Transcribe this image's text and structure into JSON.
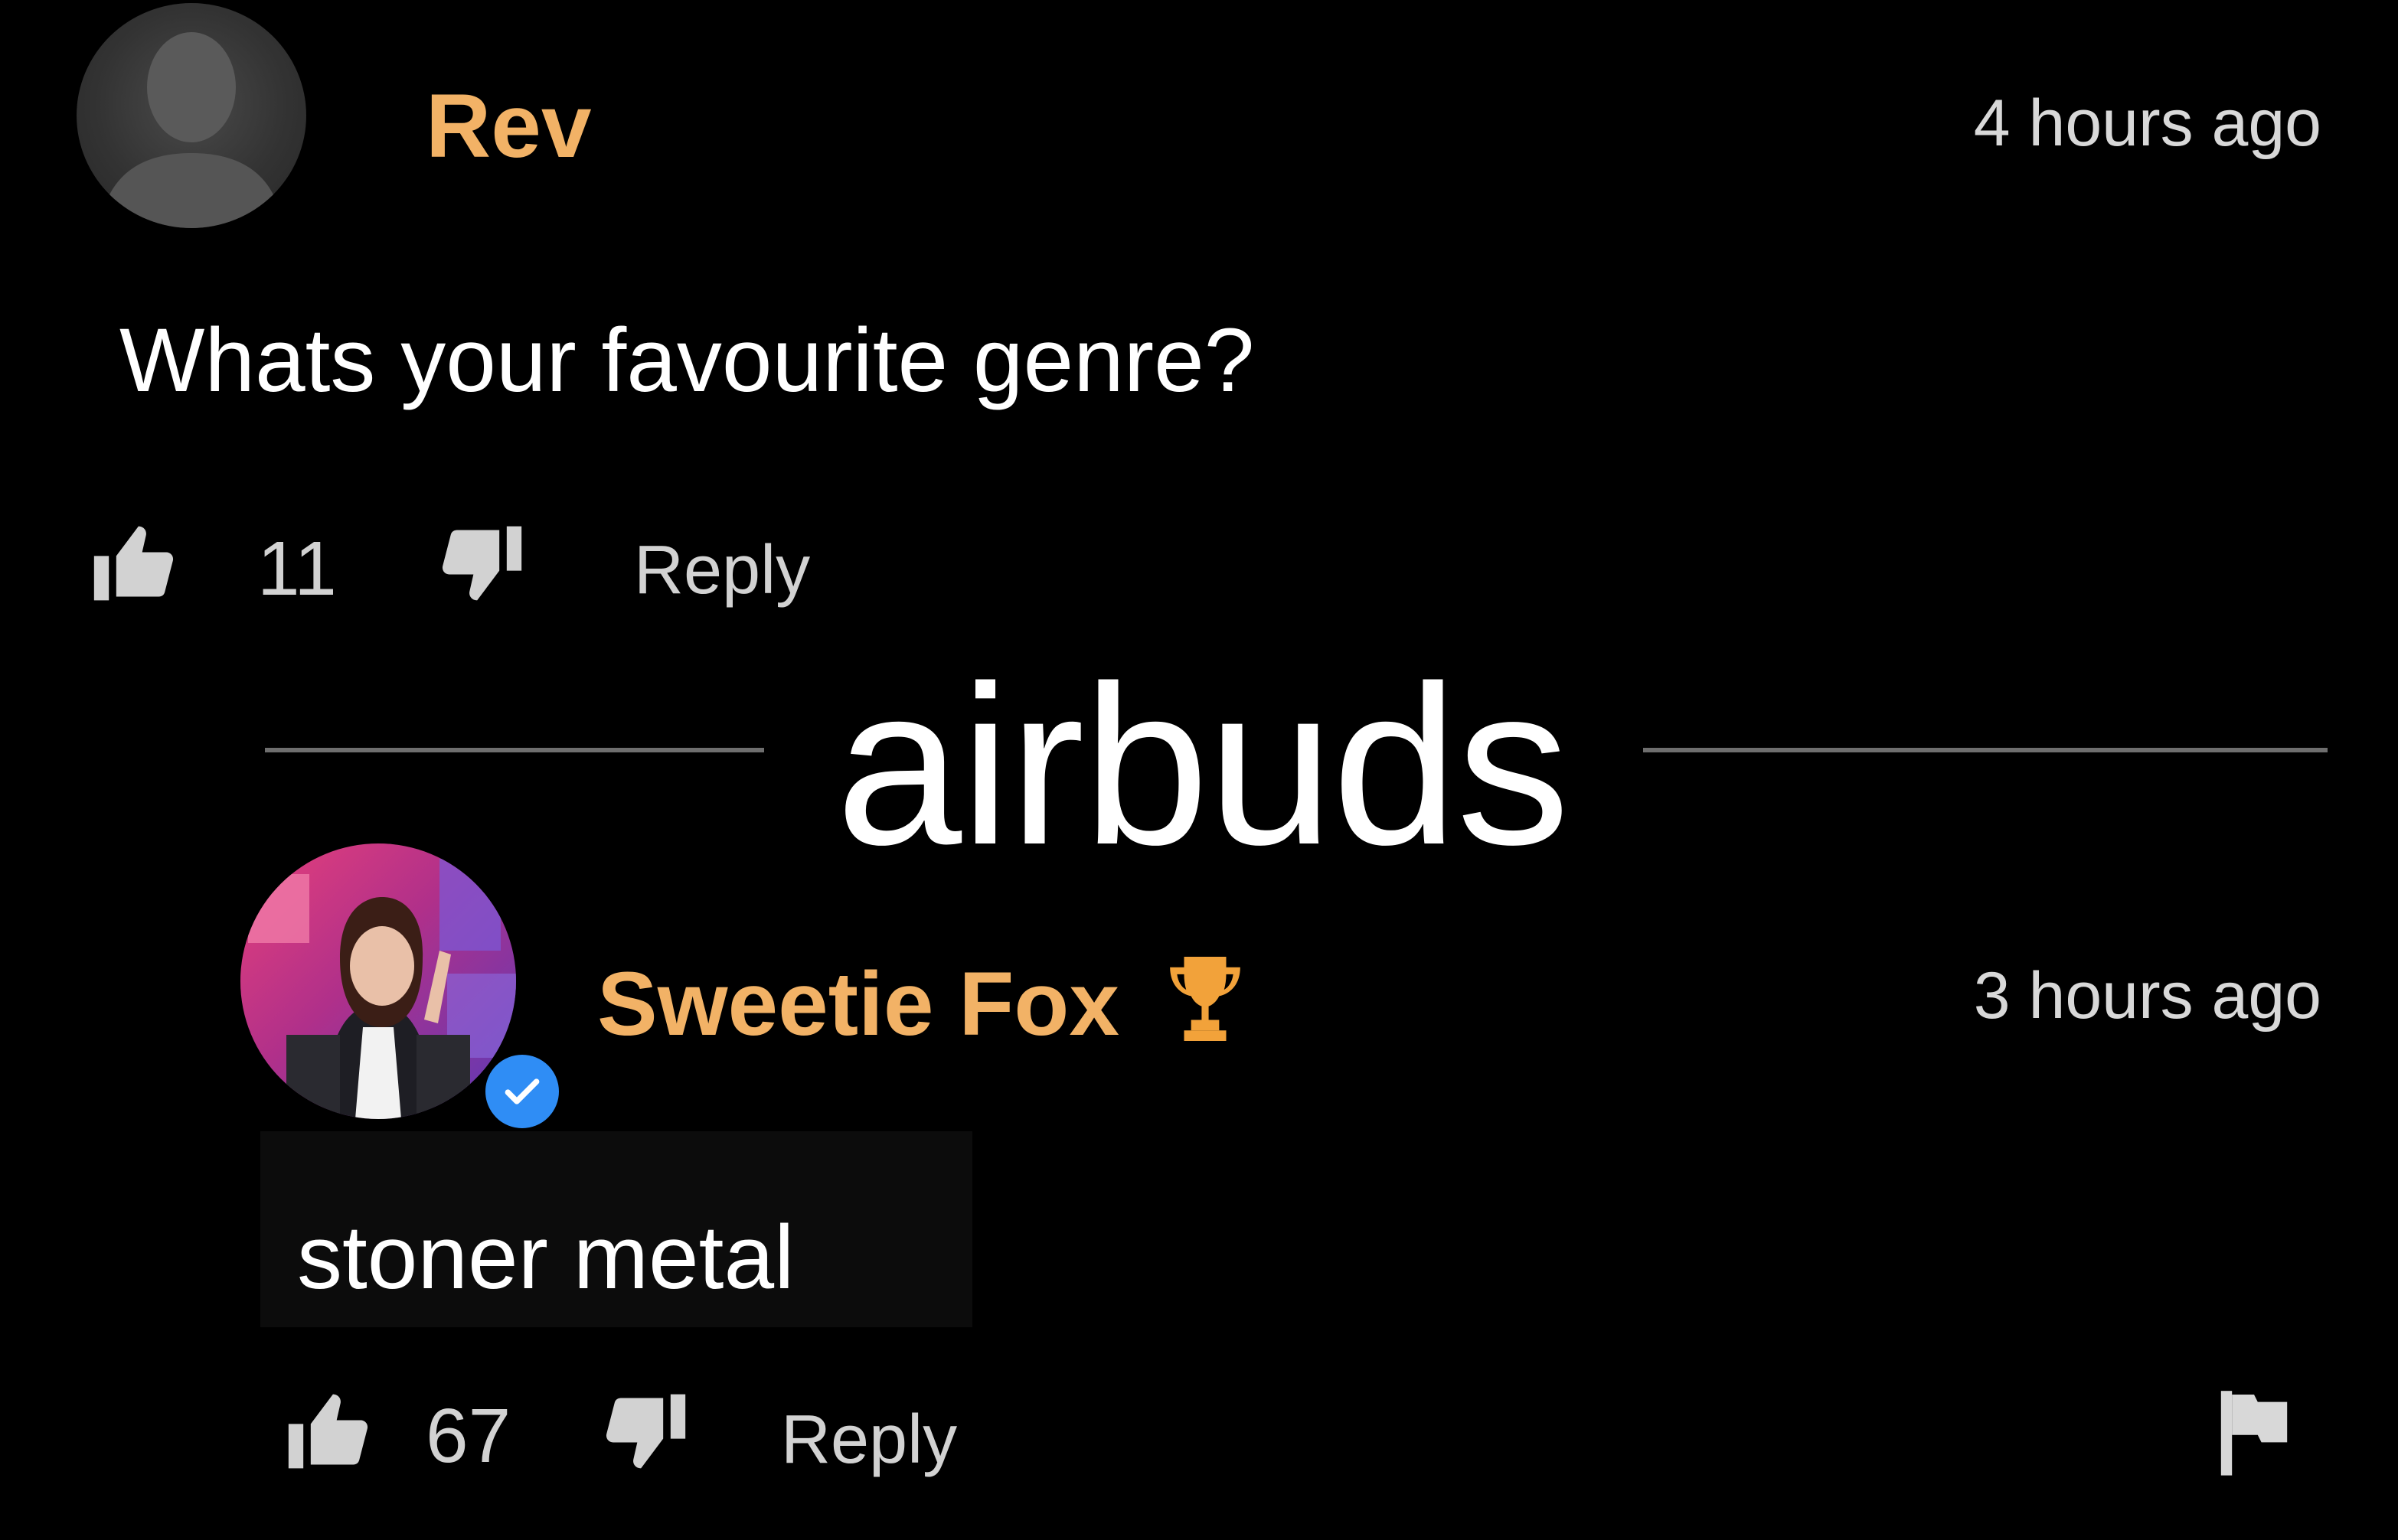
{
  "parent_comment": {
    "username": "Rev",
    "timestamp": "4 hours ago",
    "text": "Whats your favourite genre?",
    "like_count": "11",
    "reply_label": "Reply",
    "avatar_icon": "user-silhouette-icon"
  },
  "overlay": {
    "caption": "airbuds"
  },
  "reply_comment": {
    "username": "Sweetie Fox",
    "badge": "🏆",
    "timestamp": "3 hours ago",
    "text": "stoner metal",
    "like_count": "67",
    "reply_label": "Reply",
    "verified": true,
    "flag_icon": "flag-icon"
  },
  "colors": {
    "background": "#000000",
    "username": "#f2b266",
    "verified": "#2f8df5",
    "secondary_text": "#d2d2d2"
  }
}
